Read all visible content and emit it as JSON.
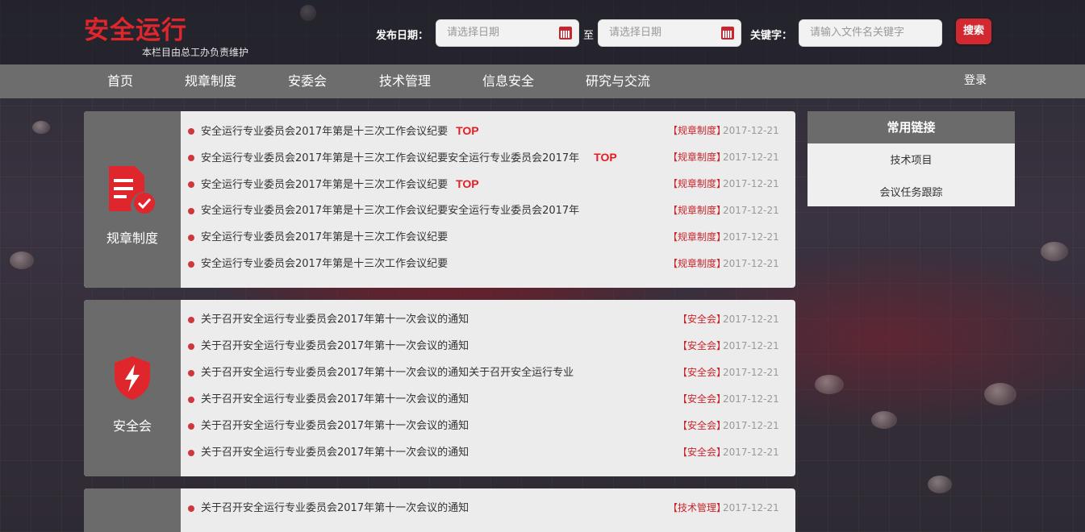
{
  "header": {
    "logo_title": "安全运行",
    "logo_subtitle": "本栏目由总工办负责维护",
    "publish_date_label": "发布日期：",
    "start_date_placeholder": "请选择日期",
    "to_label": "至",
    "end_date_placeholder": "请选择日期",
    "keyword_label": "关键字：",
    "keyword_placeholder": "请输入文件名关键字",
    "search_button": "搜索"
  },
  "nav": {
    "items": [
      "首页",
      "规章制度",
      "安委会",
      "技术管理",
      "信息安全",
      "研究与交流"
    ],
    "login": "登录"
  },
  "sections": [
    {
      "label": "规章制度",
      "icon": "document-check-icon",
      "rows": [
        {
          "title": "安全运行专业委员会2017年第是十三次工作会议纪要",
          "top": "TOP",
          "tag": "【规章制度】",
          "date": "2017-12-21"
        },
        {
          "title": "安全运行专业委员会2017年第是十三次工作会议纪要安全运行专业委员会2017年",
          "top": "TOP",
          "tag": "【规章制度】",
          "date": "2017-12-21"
        },
        {
          "title": "安全运行专业委员会2017年第是十三次工作会议纪要",
          "top": "TOP",
          "tag": "【规章制度】",
          "date": "2017-12-21"
        },
        {
          "title": "安全运行专业委员会2017年第是十三次工作会议纪要安全运行专业委员会2017年",
          "top": "",
          "tag": "【规章制度】",
          "date": "2017-12-21"
        },
        {
          "title": "安全运行专业委员会2017年第是十三次工作会议纪要",
          "top": "",
          "tag": "【规章制度】",
          "date": "2017-12-21"
        },
        {
          "title": "安全运行专业委员会2017年第是十三次工作会议纪要",
          "top": "",
          "tag": "【规章制度】",
          "date": "2017-12-21"
        }
      ]
    },
    {
      "label": "安全会",
      "icon": "shield-bolt-icon",
      "rows": [
        {
          "title": "关于召开安全运行专业委员会2017年第十一次会议的通知",
          "top": "",
          "tag": "【安全会】",
          "date": "2017-12-21"
        },
        {
          "title": "关于召开安全运行专业委员会2017年第十一次会议的通知",
          "top": "",
          "tag": "【安全会】",
          "date": "2017-12-21"
        },
        {
          "title": "关于召开安全运行专业委员会2017年第十一次会议的通知关于召开安全运行专业",
          "top": "",
          "tag": "【安全会】",
          "date": "2017-12-21"
        },
        {
          "title": "关于召开安全运行专业委员会2017年第十一次会议的通知",
          "top": "",
          "tag": "【安全会】",
          "date": "2017-12-21"
        },
        {
          "title": "关于召开安全运行专业委员会2017年第十一次会议的通知",
          "top": "",
          "tag": "【安全会】",
          "date": "2017-12-21"
        },
        {
          "title": "关于召开安全运行专业委员会2017年第十一次会议的通知",
          "top": "",
          "tag": "【安全会】",
          "date": "2017-12-21"
        }
      ]
    },
    {
      "label": "",
      "icon": "",
      "rows": [
        {
          "title": "关于召开安全运行专业委员会2017年第十一次会议的通知",
          "top": "",
          "tag": "【技术管理】",
          "date": "2017-12-21"
        }
      ]
    }
  ],
  "links": {
    "heading": "常用链接",
    "items": [
      "技术项目",
      "会议任务跟踪"
    ]
  },
  "colors": {
    "accent": "#d2282f",
    "nav_bg": "#6d6d6d",
    "panel_bg": "#ececec"
  }
}
